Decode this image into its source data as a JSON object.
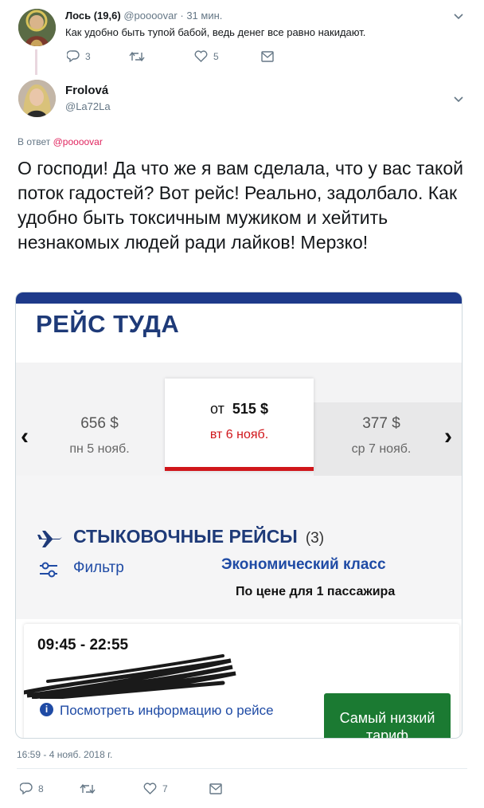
{
  "reply_tweet": {
    "author_name": "Лось (19,6)",
    "handle": "@poooovar",
    "separator": "·",
    "time_ago": "31 мин.",
    "text": "Как удобно быть тупой бабой, ведь денег все равно накидают.",
    "actions": {
      "reply_count": "3",
      "retweet_count": "",
      "like_count": "5"
    }
  },
  "main_tweet": {
    "author_name": "Frolová",
    "handle": "@La72La",
    "reply_prefix": "В ответ",
    "reply_mention": "@poooovar",
    "text": "О господи! Да что же я вам сделала, что у вас такой поток гадостей? Вот рейс! Реально, задолбало. Как удобно быть токсичным мужиком и хейтить незнакомых людей ради лайков! Мерзко!",
    "timestamp": "16:59 - 4 нояб. 2018 г.",
    "actions": {
      "reply_count": "8",
      "retweet_count": "",
      "like_count": "7"
    }
  },
  "media": {
    "title": "РЕЙС ТУДА",
    "prev_day": {
      "price": "656 $",
      "date": "пн 5 нояб."
    },
    "selected_day": {
      "from": "от",
      "price": "515 $",
      "date": "вт 6 нояб."
    },
    "next_day": {
      "price": "377 $",
      "date": "ср 7 нояб."
    },
    "section_title": "СТЫКОВОЧНЫЕ РЕЙСЫ",
    "section_count": "(3)",
    "filter_label": "Фильтр",
    "class_label": "Экономический класс",
    "price_note": "По цене для 1 пассажира",
    "result": {
      "times": "09:45 - 22:55",
      "info_icon_glyph": "i",
      "info_link": "Посмотреть информацию о рейсе",
      "lowest_fare_button": "Самый низкий тариф"
    }
  },
  "colors": {
    "airline_blue": "#1e3a78",
    "selected_red": "#d0161b",
    "button_green": "#1b7a32",
    "mention_pink": "#e0245e",
    "muted_gray": "#657786"
  },
  "icons": [
    "reply-icon",
    "retweet-icon",
    "like-icon",
    "dm-icon",
    "chevron-down-icon",
    "plane-icon",
    "filter-icon",
    "info-icon"
  ]
}
